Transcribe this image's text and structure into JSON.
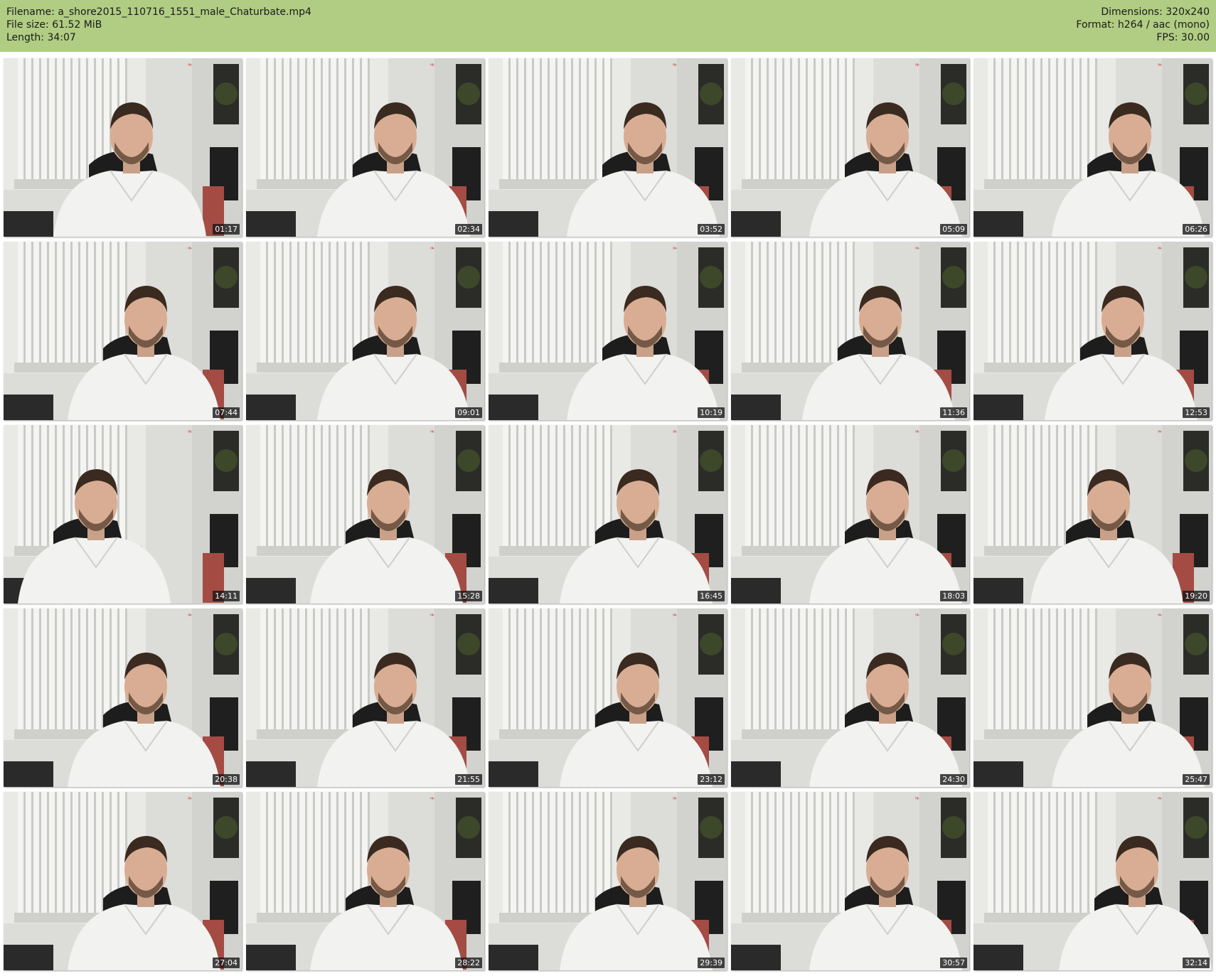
{
  "header": {
    "left": [
      {
        "key": "Filename:",
        "value": "a_shore2015_110716_1551_male_Chaturbate.mp4"
      },
      {
        "key": "File size:",
        "value": "61.52 MiB"
      },
      {
        "key": "Length:",
        "value": "34:07"
      }
    ],
    "right": [
      {
        "key": "Dimensions:",
        "value": "320x240"
      },
      {
        "key": "Format:",
        "value": "h264 / aac (mono)"
      },
      {
        "key": "FPS:",
        "value": "30.00"
      }
    ]
  },
  "colors": {
    "header_bg": "#b0cd83",
    "page_bg": "#ffffff",
    "watermark": "#d9534f"
  },
  "thumbnails": [
    {
      "timestamp": "01:17"
    },
    {
      "timestamp": "02:34"
    },
    {
      "timestamp": "03:52"
    },
    {
      "timestamp": "05:09"
    },
    {
      "timestamp": "06:26"
    },
    {
      "timestamp": "07:44"
    },
    {
      "timestamp": "09:01"
    },
    {
      "timestamp": "10:19"
    },
    {
      "timestamp": "11:36"
    },
    {
      "timestamp": "12:53"
    },
    {
      "timestamp": "14:11"
    },
    {
      "timestamp": "15:28"
    },
    {
      "timestamp": "16:45"
    },
    {
      "timestamp": "18:03"
    },
    {
      "timestamp": "19:20"
    },
    {
      "timestamp": "20:38"
    },
    {
      "timestamp": "21:55"
    },
    {
      "timestamp": "23:12"
    },
    {
      "timestamp": "24:30"
    },
    {
      "timestamp": "25:47"
    },
    {
      "timestamp": "27:04"
    },
    {
      "timestamp": "28:22"
    },
    {
      "timestamp": "29:39"
    },
    {
      "timestamp": "30:57"
    },
    {
      "timestamp": "32:14"
    }
  ]
}
